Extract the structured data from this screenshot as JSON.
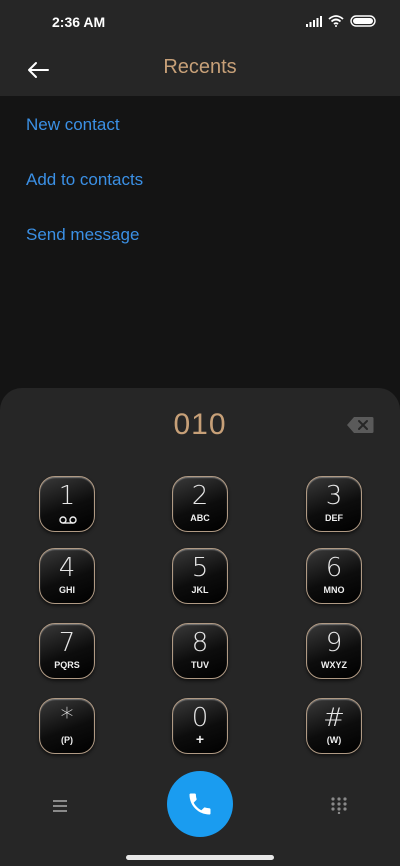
{
  "status_bar": {
    "time": "2:36 AM",
    "icons": [
      "signal-icon",
      "wifi-icon",
      "battery-icon"
    ]
  },
  "header": {
    "back_icon": "back-arrow-icon",
    "title": "Recents"
  },
  "actions": [
    {
      "label": "New contact"
    },
    {
      "label": "Add to contacts"
    },
    {
      "label": "Send message"
    }
  ],
  "dialer": {
    "number": "010",
    "backspace_icon": "backspace-icon",
    "keys": [
      {
        "digit": "1",
        "letters": "",
        "icon": "voicemail-icon"
      },
      {
        "digit": "2",
        "letters": "ABC"
      },
      {
        "digit": "3",
        "letters": "DEF"
      },
      {
        "digit": "4",
        "letters": "GHI"
      },
      {
        "digit": "5",
        "letters": "JKL"
      },
      {
        "digit": "6",
        "letters": "MNO"
      },
      {
        "digit": "7",
        "letters": "PQRS"
      },
      {
        "digit": "8",
        "letters": "TUV"
      },
      {
        "digit": "9",
        "letters": "WXYZ"
      },
      {
        "digit": "*",
        "letters": "(P)"
      },
      {
        "digit": "0",
        "letters": "+"
      },
      {
        "digit": "#",
        "letters": "(W)"
      }
    ]
  },
  "bottom_bar": {
    "menu_icon": "menu-icon",
    "call_icon": "phone-icon",
    "keypad_icon": "keypad-icon"
  },
  "colors": {
    "accent_gold": "#c7a078",
    "link_blue": "#3b90e5",
    "call_blue": "#1a9cf0"
  }
}
